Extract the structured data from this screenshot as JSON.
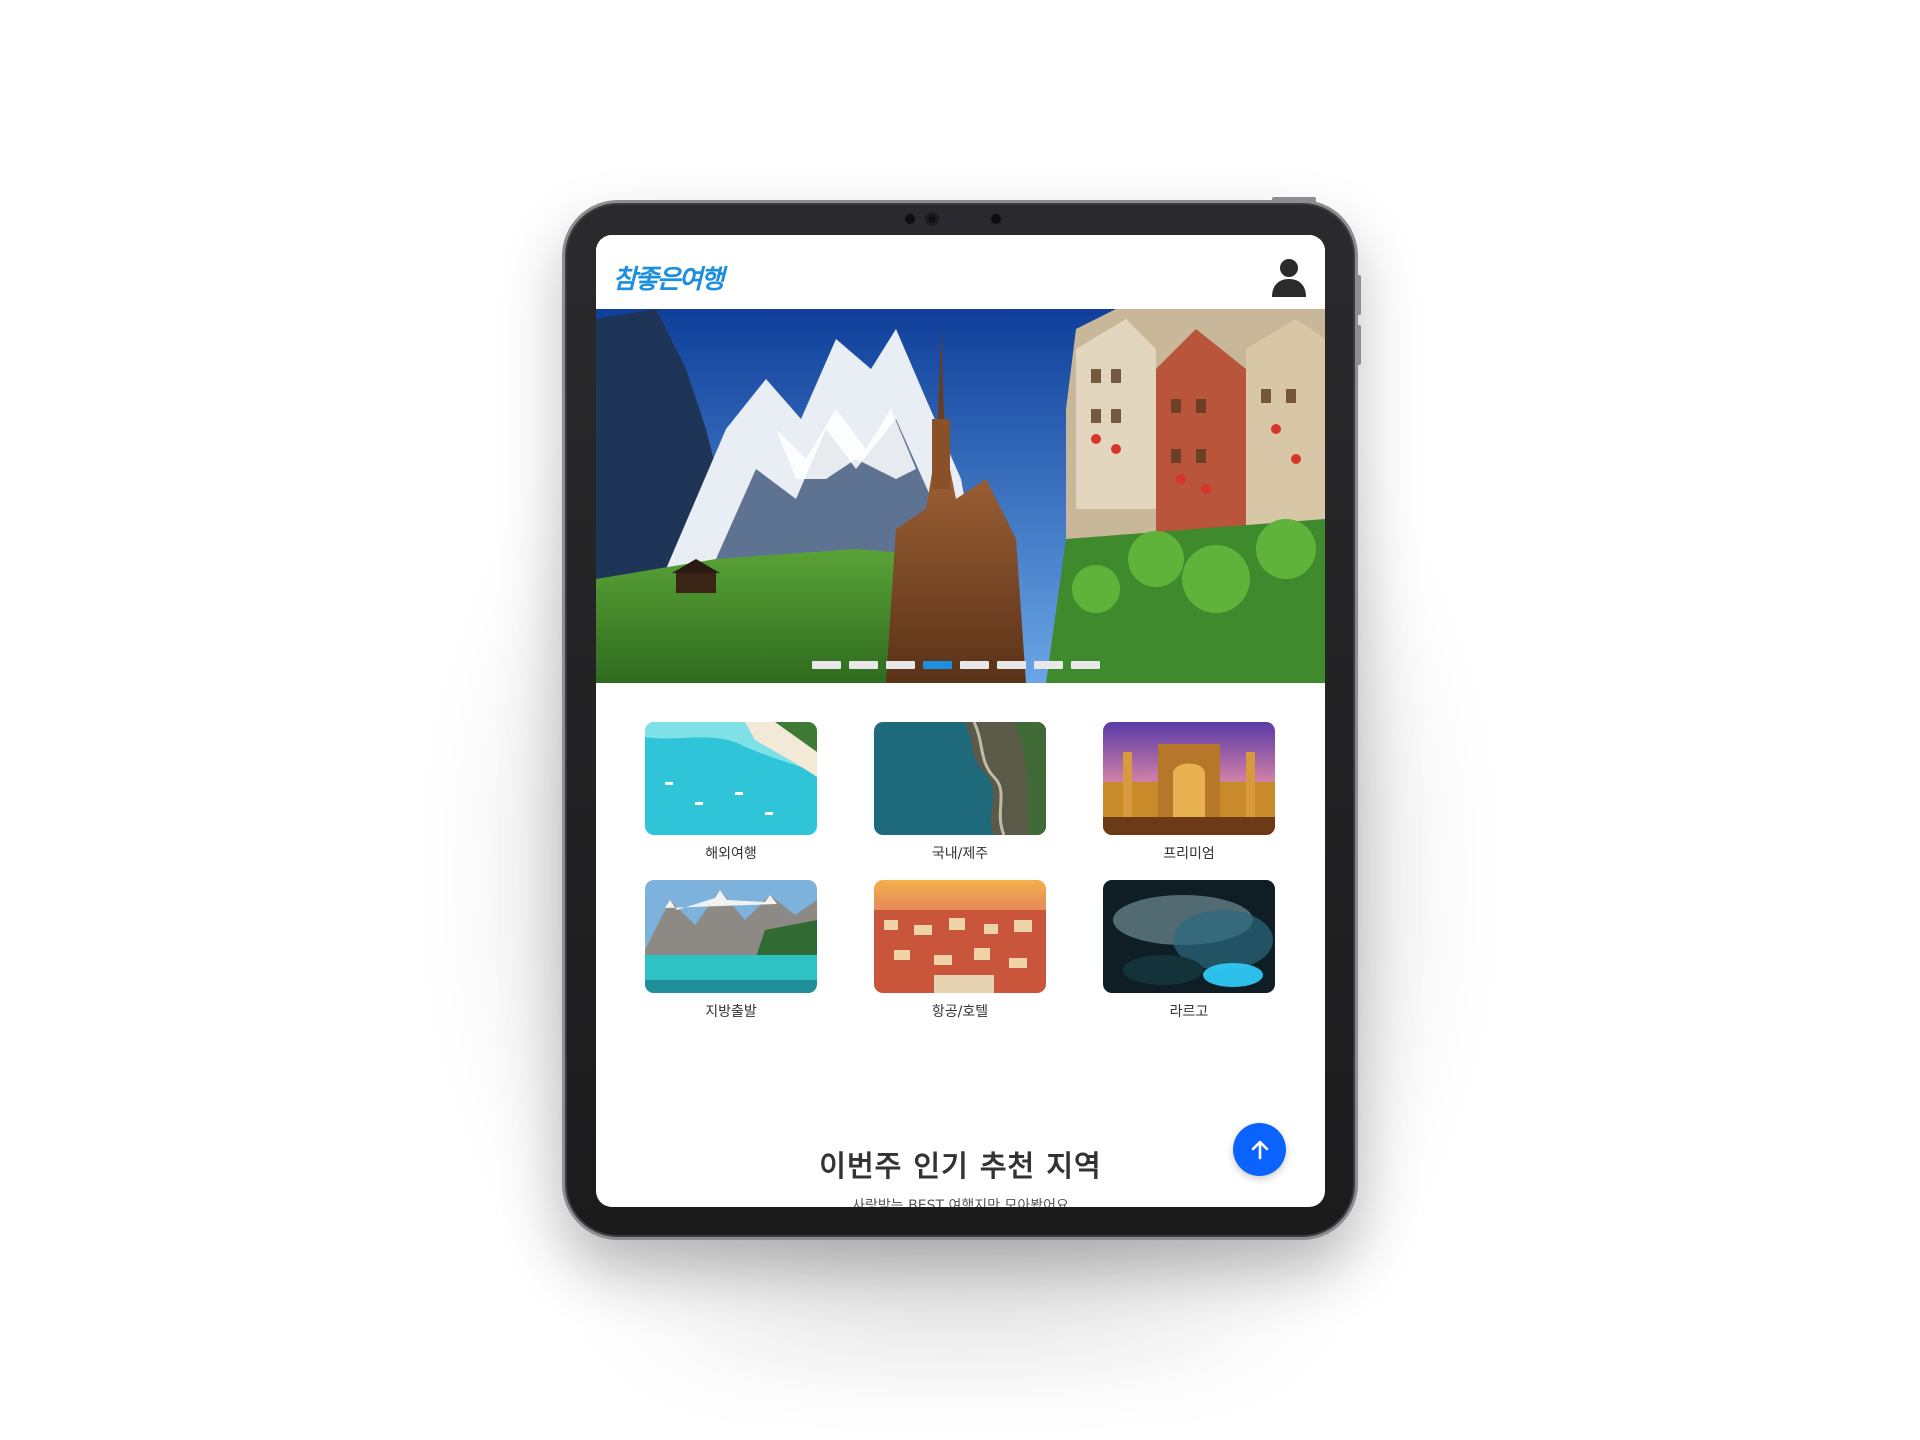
{
  "header": {
    "logo_text": "참좋은여행",
    "user_icon": "user-icon"
  },
  "hero": {
    "slide_count": 8,
    "active_slide": 4
  },
  "categories": [
    {
      "label": "해외여행",
      "image": "beach-lagoon"
    },
    {
      "label": "국내/제주",
      "image": "coastal-aerial"
    },
    {
      "label": "프리미엄",
      "image": "samarkand-mosque"
    },
    {
      "label": "지방출발",
      "image": "mountain-lake"
    },
    {
      "label": "항공/호텔",
      "image": "city-rooftops"
    },
    {
      "label": "라르고",
      "image": "blue-cave"
    }
  ],
  "section": {
    "title": "이번주 인기 추천 지역",
    "subtitle": "사랑받는 BEST 여행지만 모아봤어요"
  },
  "scroll_top": {
    "icon": "arrow-up-icon"
  },
  "colors": {
    "brand": "#1b8fe0",
    "fab": "#0a62ff",
    "text": "#333333"
  }
}
